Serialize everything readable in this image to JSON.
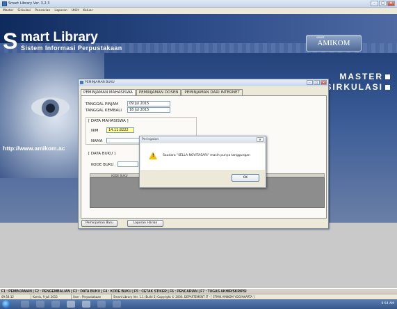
{
  "window": {
    "title": "Smart Library Ver. 3.2.3",
    "controls": {
      "minimize": "–",
      "maximize": "□",
      "close": "✕"
    }
  },
  "menu": [
    "Master",
    "Sirkulasi",
    "Pencarian",
    "Laporan",
    "Utilit",
    "Keluar"
  ],
  "banner": {
    "s": "S",
    "name": "mart Library",
    "subtitle": "Sistem Informasi Perpustakaan",
    "logo_small": "smart",
    "logo": "AMIKOM",
    "nav_master": "MASTER",
    "nav_sirkulasi": "SIRKULASI",
    "url": "http://www.amikom.ac"
  },
  "dialog": {
    "title": "PEMINJAMAN BUKU",
    "tabs": [
      "PEMINJAMAN MAHASISWA",
      "PEMINJAMAN DOSEN",
      "PEMINJAMAN DARI INTERNET"
    ],
    "tanggal_pinjam_label": "TANGGAL PINJAM",
    "tanggal_pinjam": "09 Jul 2015",
    "tanggal_kembali_label": "TANGGAL KEMBALI",
    "tanggal_kembali": "16 Jul 2015",
    "data_mahasiswa_label": "[ DATA MAHASISWA ]",
    "nim_label": "NIM",
    "nim": "14.11.8222",
    "nama_label": "NAMA",
    "data_buku_label": "[ DATA BUKU ]",
    "kode_buku_label": "KODE BUKU",
    "grid_header": "KODE BUKU",
    "btn_baru": "Peminjaman Baru",
    "btn_laporan": "Laporan Harian"
  },
  "message": {
    "title": "Peringatan",
    "close": "✕",
    "text": "Saudara \"SELLA NOVITASARI\" masih punya tanggungan",
    "ok": "OK"
  },
  "fkeys": "F1 : PEMINJAMAN | F2 : PENGEMBALIAN | F3 : DATA BUKU | F4 : KODE BUKU | F5 : CETAK STIKER | F6 : PENCARIAN | F7 : TUGAS AKHIR/SKRIPSI",
  "status": {
    "time": "09:54:12",
    "date": "Kamis, 9 Juli 2015",
    "user": "User : Perpustakaan",
    "copyright": "Smart Library Ver. 1.1 (Build 5) Copyright © 2006. DEPARTEMENT IT - [ STMIK AMIKOM YOGYAKARTA ]"
  },
  "taskbar": {
    "clock": "9:54 AM"
  }
}
